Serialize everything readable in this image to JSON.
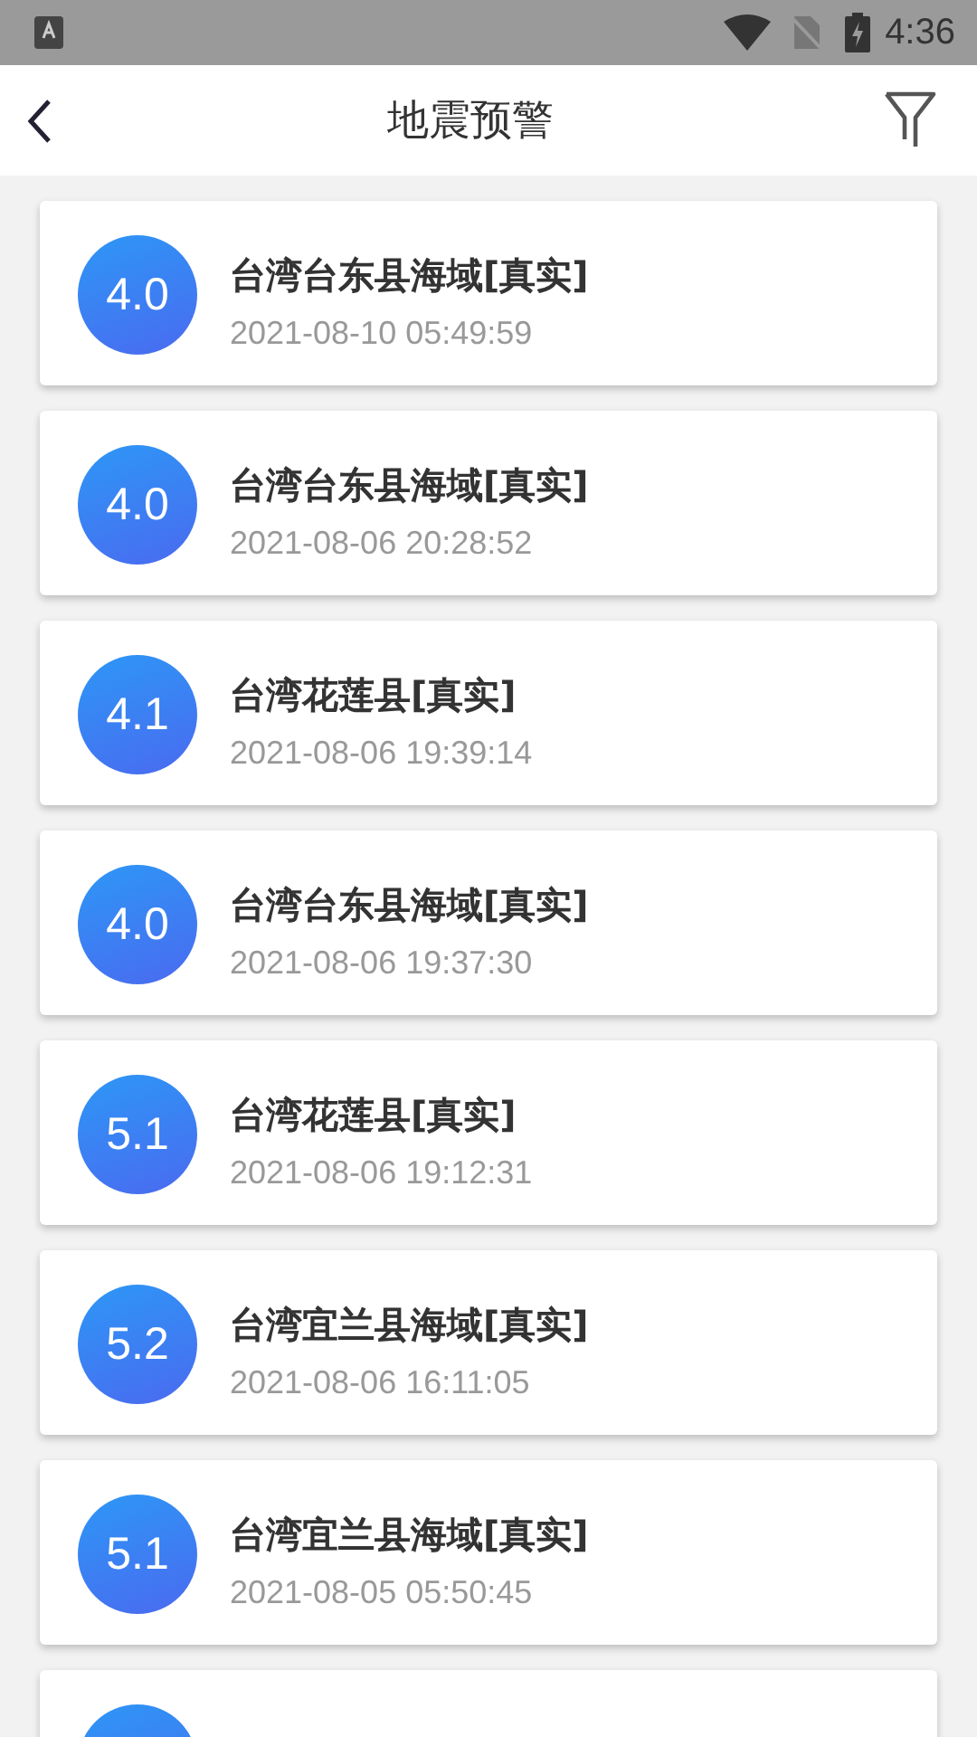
{
  "status_bar": {
    "time": "4:36"
  },
  "app_bar": {
    "title": "地震预警"
  },
  "events": [
    {
      "kind": "full",
      "magnitude": "4.0",
      "place": "台湾台东县海域[真实]",
      "time": "2021-08-10 05:49:59"
    },
    {
      "kind": "full",
      "magnitude": "4.0",
      "place": "台湾台东县海域[真实]",
      "time": "2021-08-06 20:28:52"
    },
    {
      "kind": "full",
      "magnitude": "4.1",
      "place": "台湾花莲县[真实]",
      "time": "2021-08-06 19:39:14"
    },
    {
      "kind": "full",
      "magnitude": "4.0",
      "place": "台湾台东县海域[真实]",
      "time": "2021-08-06 19:37:30"
    },
    {
      "kind": "full",
      "magnitude": "5.1",
      "place": "台湾花莲县[真实]",
      "time": "2021-08-06 19:12:31"
    },
    {
      "kind": "full",
      "magnitude": "5.2",
      "place": "台湾宜兰县海域[真实]",
      "time": "2021-08-06 16:11:05"
    },
    {
      "kind": "full",
      "magnitude": "5.1",
      "place": "台湾宜兰县海域[真实]",
      "time": "2021-08-05 05:50:45"
    },
    {
      "kind": "cut"
    }
  ]
}
